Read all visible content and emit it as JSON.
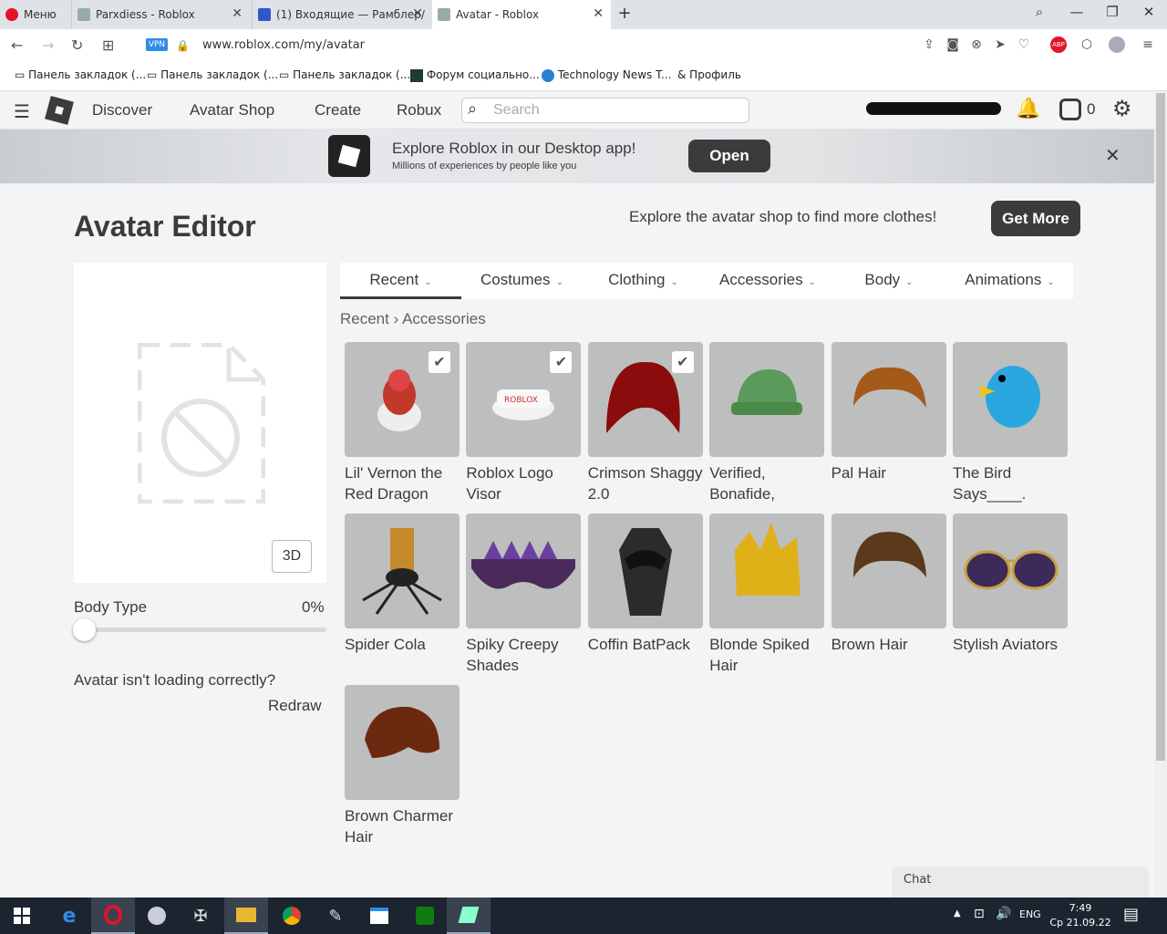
{
  "browser": {
    "menu_label": "Меню",
    "tabs": [
      {
        "title": "Parxdiess - Roblox"
      },
      {
        "title": "(1) Входящие — Рамблер/"
      },
      {
        "title": "Avatar - Roblox"
      }
    ],
    "new_tab": "+",
    "vpn_label": "VPN",
    "url": "www.roblox.com/my/avatar",
    "bookmarks": [
      {
        "label": "Панель закладок (..."
      },
      {
        "label": "Панель закладок (..."
      },
      {
        "label": "Панель закладок (..."
      },
      {
        "label": "Форум социально..."
      },
      {
        "label": "Technology News T..."
      },
      {
        "label": "Профиль"
      }
    ]
  },
  "header": {
    "nav": [
      "Discover",
      "Avatar Shop",
      "Create",
      "Robux"
    ],
    "search_placeholder": "Search",
    "robux_count": "0"
  },
  "banner": {
    "title": "Explore Roblox in our Desktop app!",
    "subtitle": "Millions of experiences by people like you",
    "open_label": "Open"
  },
  "page": {
    "title": "Avatar Editor",
    "promo_text": "Explore the avatar shop to find more clothes!",
    "get_more_label": "Get More",
    "btn_3d": "3D",
    "body_type_label": "Body Type",
    "body_type_value": "0%",
    "body_type_fraction": 0,
    "loading_text": "Avatar isn't loading correctly?",
    "redraw_label": "Redraw",
    "chat_label": "Chat"
  },
  "category_tabs": [
    "Recent",
    "Costumes",
    "Clothing",
    "Accessories",
    "Body",
    "Animations"
  ],
  "breadcrumb": {
    "root": "Recent",
    "separator": "›",
    "current": "Accessories"
  },
  "items": [
    {
      "name": "Lil' Vernon the Red Dragon",
      "checked": true
    },
    {
      "name": "Roblox Logo Visor",
      "checked": true
    },
    {
      "name": "Crimson Shaggy 2.0",
      "checked": true
    },
    {
      "name": "Verified, Bonafide,",
      "checked": false
    },
    {
      "name": "Pal Hair",
      "checked": false
    },
    {
      "name": "The Bird Says____.",
      "checked": false
    },
    {
      "name": "Spider Cola",
      "checked": false
    },
    {
      "name": "Spiky Creepy Shades",
      "checked": false
    },
    {
      "name": "Coffin BatPack",
      "checked": false
    },
    {
      "name": "Blonde Spiked Hair",
      "checked": false
    },
    {
      "name": "Brown Hair",
      "checked": false
    },
    {
      "name": "Stylish Aviators",
      "checked": false
    },
    {
      "name": "Brown Charmer Hair",
      "checked": false
    }
  ],
  "taskbar": {
    "language": "ENG",
    "time": "7:49",
    "date": "Ср 21.09.22"
  }
}
